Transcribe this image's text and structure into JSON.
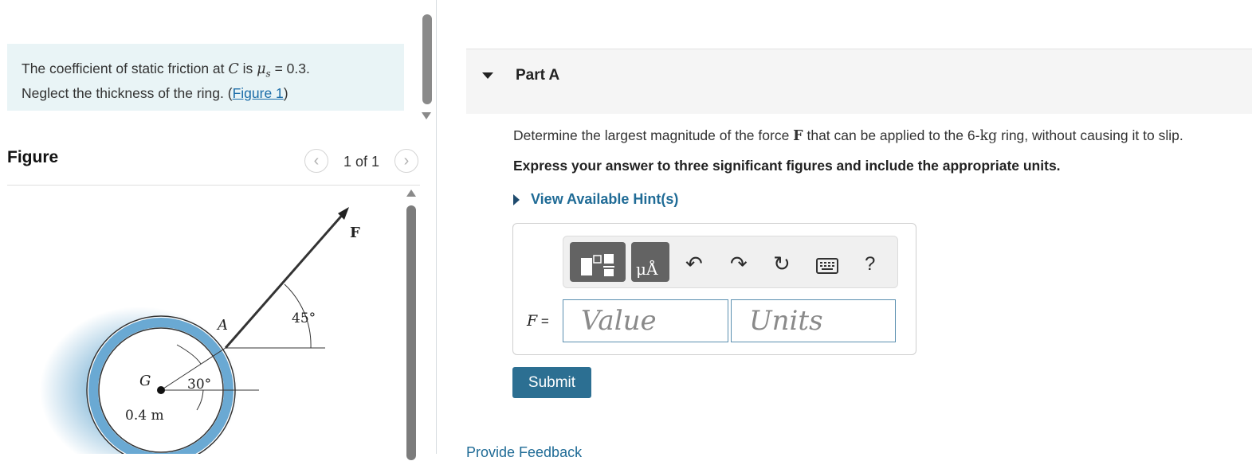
{
  "problem": {
    "text_before": "The coefficient of static friction at ",
    "var_c": "C",
    "text_is": " is ",
    "var_mu": "μ",
    "var_mu_sub": "s",
    "text_value": " = 0.3.",
    "line2": "Neglect the thickness of the ring. (",
    "figure_link": "Figure 1",
    "line2_end": ")"
  },
  "figure_panel": {
    "title": "Figure",
    "pager": "1 of 1",
    "prev_icon": "chevron-left-icon",
    "next_icon": "chevron-right-icon"
  },
  "diagram": {
    "force_label": "F",
    "point_a": "A",
    "point_g": "G",
    "angle_45": "45°",
    "angle_30": "30°",
    "radius": "0.4 m"
  },
  "part": {
    "title": "Part A",
    "question_pre": "Determine the largest magnitude of the force ",
    "question_var": "F",
    "question_mid": " that can be applied to the 6-",
    "question_unit": "kg",
    "question_post": " ring, without causing it to slip.",
    "instruction": "Express your answer to three significant figures and include the appropriate units.",
    "hint": "View Available Hint(s)",
    "answer_label": "F",
    "answer_eq": " =",
    "value_placeholder": "Value",
    "units_placeholder": "Units",
    "submit": "Submit",
    "feedback": "Provide Feedback",
    "toolbar_help": "?",
    "units_button_text": "μÅ"
  },
  "colors": {
    "accent": "#2c6f92",
    "link": "#1f6b96",
    "problem_bg": "#e9f4f6"
  }
}
